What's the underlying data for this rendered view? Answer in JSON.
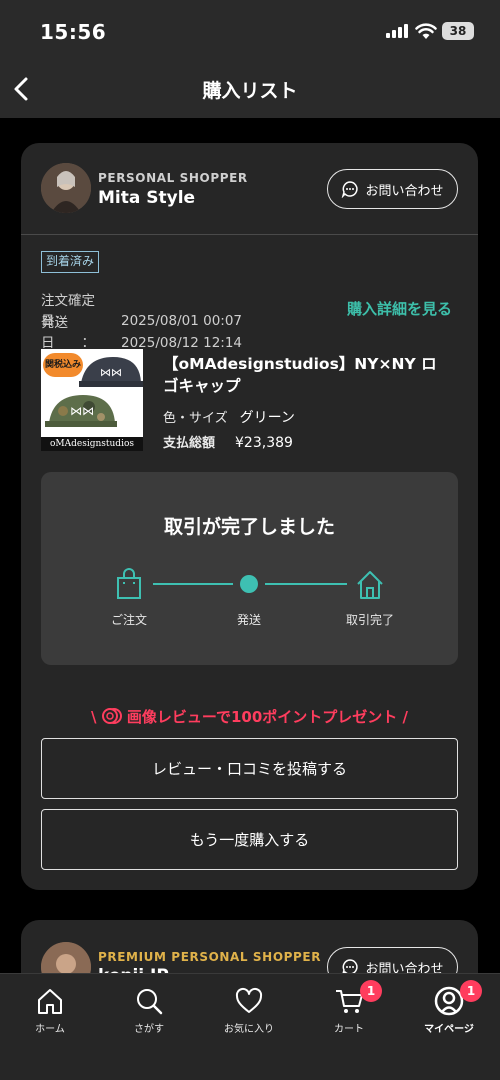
{
  "status_bar": {
    "time": "15:56",
    "battery": "38"
  },
  "nav": {
    "title": "購入リスト"
  },
  "orders": [
    {
      "shopper_type": "PERSONAL SHOPPER",
      "shopper_name": "Mita Style",
      "contact_label": "お問い合わせ",
      "status": "到着済み",
      "order_date_label": "注文確定日：",
      "order_date": "2025/08/01 00:07",
      "ship_date_label": "発送日　　：",
      "ship_date": "2025/08/12 12:14",
      "detail_link": "購入詳細を見る",
      "product": {
        "title": "【oMAdesignstudios】NY×NY ロゴキャップ",
        "tax_badge": "関税込み",
        "brand": "oMAdesignstudios",
        "attr_label": "色・サイズ",
        "attr_value": "グリーン",
        "total_label": "支払総額",
        "total_value": "¥23,389"
      },
      "progress": {
        "title": "取引が完了しました",
        "steps": [
          {
            "label": "ご注文",
            "icon": "shopping-bag-icon"
          },
          {
            "label": "発送",
            "icon": "dot"
          },
          {
            "label": "取引完了",
            "icon": "home-icon"
          }
        ]
      },
      "promo": "画像レビューで100ポイントプレゼント",
      "review_button": "レビュー・口コミを投稿する",
      "rebuy_button": "もう一度購入する"
    },
    {
      "shopper_type": "PREMIUM PERSONAL SHOPPER",
      "shopper_name": "kenji JP",
      "contact_label": "お問い合わせ"
    }
  ],
  "tabbar": {
    "items": [
      {
        "label": "ホーム",
        "icon": "home-icon"
      },
      {
        "label": "さがす",
        "icon": "search-icon"
      },
      {
        "label": "お気に入り",
        "icon": "heart-icon"
      },
      {
        "label": "カート",
        "icon": "cart-icon",
        "badge": "1"
      },
      {
        "label": "マイページ",
        "icon": "user-icon",
        "badge": "1"
      }
    ]
  },
  "colors": {
    "accent": "#3ec0b2",
    "promo": "#ff3d5e",
    "premium": "#e0b24a",
    "status_badge": "#a6d2e6"
  }
}
